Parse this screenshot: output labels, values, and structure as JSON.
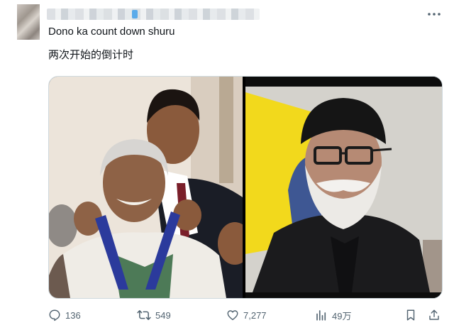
{
  "post": {
    "text_line1": "Dono ka count down shuru",
    "text_line2": "两次开始的倒计时",
    "more_icon": "more-horizontal-icon"
  },
  "media": {
    "left_image": "photo-medal-ceremony",
    "right_image": "photo-man-black-turban-glasses-beard"
  },
  "actions": {
    "replies": "136",
    "reposts": "549",
    "likes": "7,277",
    "views": "49万"
  },
  "colors": {
    "text": "#0f1419",
    "muted": "#536471",
    "border": "#cfd9de",
    "medal_ribbon": "#2b3a9c",
    "flag_yellow": "#f2d91c"
  }
}
